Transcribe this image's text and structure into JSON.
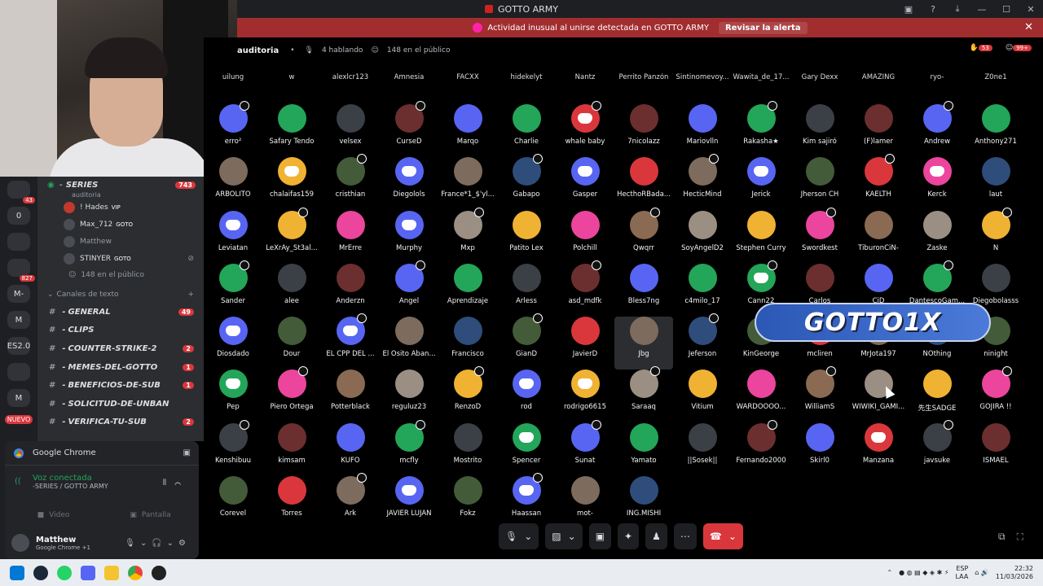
{
  "window": {
    "title": "GOTTO ARMY"
  },
  "alert": {
    "text": "Actividad inusual al unirse detectada en GOTTO ARMY",
    "action": "Revisar la alerta"
  },
  "servers": {
    "items": [
      {
        "label": "",
        "badge": "43"
      },
      {
        "label": "0",
        "badge": ""
      },
      {
        "label": "",
        "badge": ""
      },
      {
        "label": "",
        "badge": "827"
      },
      {
        "label": "M-",
        "badge": ""
      },
      {
        "label": "M",
        "badge": ""
      },
      {
        "label": "ES2.0",
        "badge": ""
      },
      {
        "label": "",
        "badge": ""
      },
      {
        "label": "M",
        "badge": ""
      }
    ],
    "new_label": "NUEVO"
  },
  "voice_channel": {
    "name": "SERIES",
    "count": "743",
    "subtitle": "auditoria",
    "members": [
      {
        "name": "! Hades",
        "tag": "VIP"
      },
      {
        "name": "Max_712",
        "tag": "GOTO"
      },
      {
        "name": "Matthew",
        "tag": ""
      },
      {
        "name": "STINYER",
        "tag": "GOTO"
      }
    ],
    "audience": "148 en el público"
  },
  "category": "Canales de texto",
  "text_channels": [
    {
      "name": "GENERAL",
      "badge": "49"
    },
    {
      "name": "CLIPS",
      "badge": ""
    },
    {
      "name": "COUNTER-STRIKE-2",
      "badge": "2"
    },
    {
      "name": "MEMES-DEL-GOTTO",
      "badge": "1"
    },
    {
      "name": "BENEFICIOS-DE-SUB",
      "badge": "1"
    },
    {
      "name": "SOLICITUD-DE-UNBAN",
      "badge": ""
    },
    {
      "name": "VERIFICA-TU-SUB",
      "badge": "2"
    }
  ],
  "panel": {
    "app": "Google Chrome",
    "voice_status": "Voz conectada",
    "voice_location": "-SERIES / GOTTO ARMY",
    "video": "Video",
    "screen": "Pantalla",
    "user": "Matthew",
    "user_status": "Google Chrome +1"
  },
  "stage": {
    "name": "auditoria",
    "speaking": "4 hablando",
    "public": "148 en el público",
    "hand_count": "53",
    "extra_badge": "99+",
    "top_row": [
      "uilung",
      "w",
      "alexlcr123",
      "Amnesia",
      "FACXX",
      "hidekelyt",
      "Nantz",
      "Perrito Panzón",
      "Sintinomevoy...",
      "Wawita_de_17...",
      "Gary Dexx",
      "AMAZING",
      "ryo-",
      "Z0ne1"
    ],
    "rows": [
      [
        "erro²",
        "Safary Tendo",
        "velsex",
        "CurseD",
        "Marqo",
        "Charlie",
        "whale baby",
        "7nicolazz",
        "Mariovlln",
        "Rakasha★",
        "Kim sajiró",
        "(F)lamer",
        "Andrew",
        "Anthony271"
      ],
      [
        "ARBOLITO",
        "chalaifas159",
        "cristhian",
        "Diegolols",
        "France*1_$'yl...",
        "Gabapo",
        "Gasper",
        "HecthoRBada...",
        "HecticMind",
        "Jerick",
        "Jherson CH",
        "KAELTH",
        "Kerck",
        "laut"
      ],
      [
        "Leviatan",
        "LeXrAy_St3al...",
        "MrErre",
        "Murphy",
        "Mxp",
        "Patito Lex",
        "Polchill",
        "Qwqrr",
        "SoyAngelD2",
        "Stephen Curry",
        "Swordkest",
        "TiburonCiN-",
        "Zaske",
        "Ñ"
      ],
      [
        "Sander",
        "alee",
        "Anderzn",
        "Angel",
        "Aprendizaje",
        "Arless",
        "asd_mdfk",
        "Bless7ng",
        "c4milo_17",
        "Cann22",
        "Carlos",
        "CiD",
        "DantescoGam...",
        "Diegobolasss"
      ],
      [
        "Diosdado",
        "Dour",
        "EL CPP DEL ...",
        "El Osito Aban...",
        "Francisco",
        "GianD",
        "JavierD",
        "Jbg",
        "Jeferson",
        "KinGeorge",
        "mcliren",
        "MrJota197",
        "NOthing",
        "ninight"
      ],
      [
        "Pep",
        "Piero Ortega",
        "Potterblack",
        "reguluz23",
        "RenzoD",
        "rod",
        "rodrigo6615",
        "Saraaq",
        "Vitium",
        "WARDOOOO...",
        "WilliamS",
        "WIWIKI_GAMI...",
        "先生SADGE",
        "GOJIRA !!"
      ],
      [
        "Kenshibuu",
        "kimsam",
        "KUFO",
        "mcfly",
        "Mostrito",
        "Spencer",
        "Sunat",
        "Yamato",
        "||Sosek||",
        "Fernando2000",
        "Skirl0",
        "Manzana",
        "javsuke",
        "ISMAEL"
      ],
      [
        "Corevel",
        "Torres",
        "Ark",
        "JAVIER LUJAN",
        "Fokz",
        "Haassan",
        "mot-",
        "ING.MISHI"
      ]
    ],
    "overlay_logo": "GOTTO1X"
  },
  "taskbar": {
    "lang": "ESP",
    "lang2": "LAA",
    "time": "22:32",
    "date": "11/03/2026"
  },
  "colors": {
    "discord_blurple": "#5865f2",
    "alert_red": "#a12d2f",
    "online_green": "#23a55a",
    "end_call": "#da373c"
  }
}
